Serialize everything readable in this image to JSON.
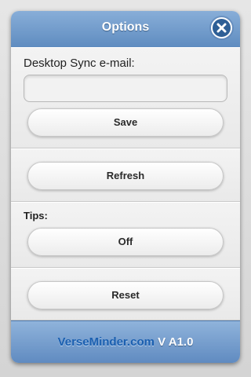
{
  "header": {
    "title": "Options"
  },
  "sync": {
    "label": "Desktop Sync e-mail:",
    "email_value": "",
    "save_label": "Save"
  },
  "refresh": {
    "label": "Refresh"
  },
  "tips": {
    "label": "Tips:",
    "toggle_label": "Off"
  },
  "reset": {
    "label": "Reset"
  },
  "footer": {
    "link_text": "VerseMinder.com",
    "version": "V A1.0"
  },
  "icons": {
    "close": "close-icon"
  },
  "colors": {
    "header_blue": "#6f98c9",
    "close_blue": "#2e5f96",
    "link_blue": "#1a5fb0"
  }
}
